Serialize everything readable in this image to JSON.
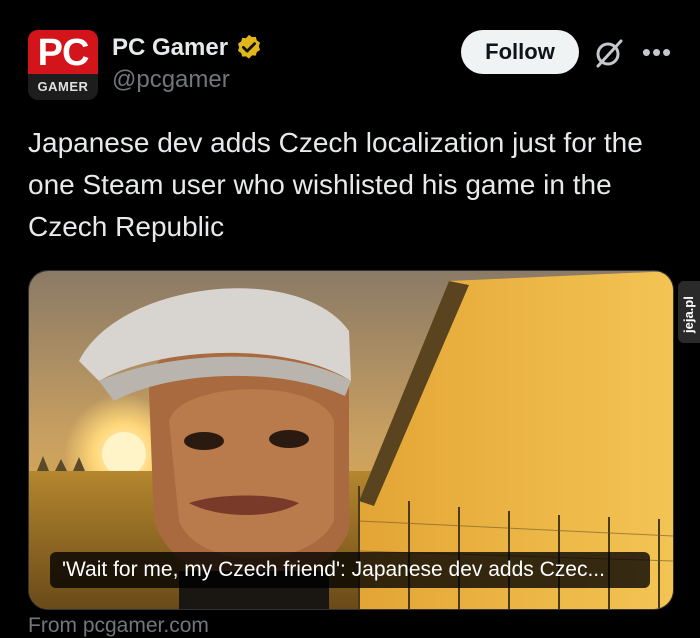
{
  "author": {
    "logo_top": "PC",
    "logo_bottom": "GAMER",
    "display_name": "PC Gamer",
    "handle": "@pcgamer",
    "verified_color": "#e2b719"
  },
  "actions": {
    "follow_label": "Follow",
    "grok_icon": "grok-icon",
    "more_icon": "more-icon",
    "more_label": "•••"
  },
  "tweet": {
    "text": "Japanese dev adds Czech localization just for the one Steam user who wishlisted his game in the Czech Republic"
  },
  "card": {
    "image_desc": "video game character in white cap at sunset by a wall",
    "caption": "'Wait for me, my Czech friend': Japanese dev adds Czec...",
    "source": "From pcgamer.com"
  },
  "watermark": {
    "text": "jeja.pl"
  },
  "colors": {
    "brand_red": "#d3151b",
    "background": "#000000",
    "secondary_text": "#71767b"
  }
}
